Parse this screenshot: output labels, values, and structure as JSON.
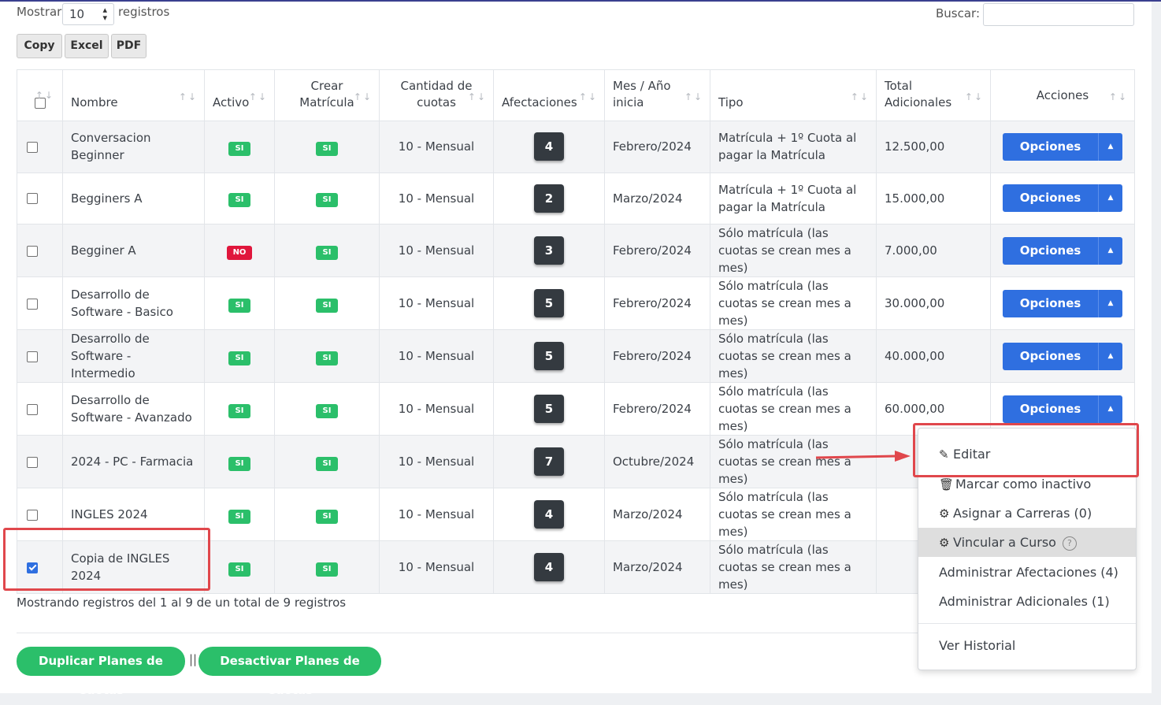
{
  "controls": {
    "show_label": "Mostrar",
    "page_size": "10",
    "records_label": "registros",
    "search_label": "Buscar:",
    "search_value": ""
  },
  "export_buttons": [
    "Copy",
    "Excel",
    "PDF"
  ],
  "columns": [
    "",
    "Nombre",
    "Activo",
    "Crear Matrícula",
    "Cantidad de cuotas",
    "Afectaciones",
    "Mes / Año inicia",
    "Tipo",
    "Total Adicionales",
    "Acciones"
  ],
  "sort_glyph": "↑↓",
  "rows": [
    {
      "checked": false,
      "nombre": "Conversacion Beginner",
      "activo": "SI",
      "crear": "SI",
      "cuotas": "10 - Mensual",
      "afect": "4",
      "mes": "Febrero/2024",
      "tipo": "Matrícula + 1º Cuota al pagar la Matrícula",
      "total": "12.500,00",
      "accion": "Opciones"
    },
    {
      "checked": false,
      "nombre": "Begginers A",
      "activo": "SI",
      "crear": "SI",
      "cuotas": "10 - Mensual",
      "afect": "2",
      "mes": "Marzo/2024",
      "tipo": "Matrícula + 1º Cuota al pagar la Matrícula",
      "total": "15.000,00",
      "accion": "Opciones"
    },
    {
      "checked": false,
      "nombre": "Begginer A",
      "activo": "NO",
      "crear": "SI",
      "cuotas": "10 - Mensual",
      "afect": "3",
      "mes": "Febrero/2024",
      "tipo": "Sólo matrícula (las cuotas se crean mes a mes)",
      "total": "7.000,00",
      "accion": "Opciones"
    },
    {
      "checked": false,
      "nombre": "Desarrollo de Software - Basico",
      "activo": "SI",
      "crear": "SI",
      "cuotas": "10 - Mensual",
      "afect": "5",
      "mes": "Febrero/2024",
      "tipo": "Sólo matrícula (las cuotas se crean mes a mes)",
      "total": "30.000,00",
      "accion": "Opciones"
    },
    {
      "checked": false,
      "nombre": "Desarrollo de Software - Intermedio",
      "activo": "SI",
      "crear": "SI",
      "cuotas": "10 - Mensual",
      "afect": "5",
      "mes": "Febrero/2024",
      "tipo": "Sólo matrícula (las cuotas se crean mes a mes)",
      "total": "40.000,00",
      "accion": "Opciones"
    },
    {
      "checked": false,
      "nombre": "Desarrollo de Software - Avanzado",
      "activo": "SI",
      "crear": "SI",
      "cuotas": "10 - Mensual",
      "afect": "5",
      "mes": "Febrero/2024",
      "tipo": "Sólo matrícula (las cuotas se crean mes a mes)",
      "total": "60.000,00",
      "accion": "Opciones"
    },
    {
      "checked": false,
      "nombre": "2024 - PC - Farmacia",
      "activo": "SI",
      "crear": "SI",
      "cuotas": "10 - Mensual",
      "afect": "7",
      "mes": "Octubre/2024",
      "tipo": "Sólo matrícula (las cuotas se crean mes a mes)",
      "total": "",
      "accion": ""
    },
    {
      "checked": false,
      "nombre": "INGLES 2024",
      "activo": "SI",
      "crear": "SI",
      "cuotas": "10 - Mensual",
      "afect": "4",
      "mes": "Marzo/2024",
      "tipo": "Sólo matrícula (las cuotas se crean mes a mes)",
      "total": "",
      "accion": ""
    },
    {
      "checked": true,
      "nombre": "Copia de INGLES 2024",
      "activo": "SI",
      "crear": "SI",
      "cuotas": "10 - Mensual",
      "afect": "4",
      "mes": "Marzo/2024",
      "tipo": "Sólo matrícula (las cuotas se crean mes a mes)",
      "total": "",
      "accion": ""
    }
  ],
  "info_text": "Mostrando registros del 1 al 9 de un total de 9 registros",
  "bottom": {
    "duplicate": "Duplicar Planes de Cuotas",
    "separator": "||",
    "deactivate": "Desactivar Planes de Cuotas"
  },
  "dropdown": {
    "items": [
      {
        "label": "Editar",
        "icon": "edit-icon"
      },
      {
        "label": "Marcar como inactivo",
        "icon": "trash-icon"
      },
      {
        "label": "Asignar a Carreras (0)",
        "icon": "gear-icon"
      },
      {
        "label": "Vincular a Curso",
        "icon": "gear-icon",
        "help": "?"
      },
      {
        "label": "Administrar Afectaciones (4)"
      },
      {
        "label": "Administrar Adicionales (1)"
      },
      {
        "label": "Ver Historial"
      }
    ]
  },
  "colors": {
    "primary": "#2f6fe0",
    "success": "#2bbf6a",
    "danger": "#e0163c",
    "annotation": "#e0474c"
  }
}
